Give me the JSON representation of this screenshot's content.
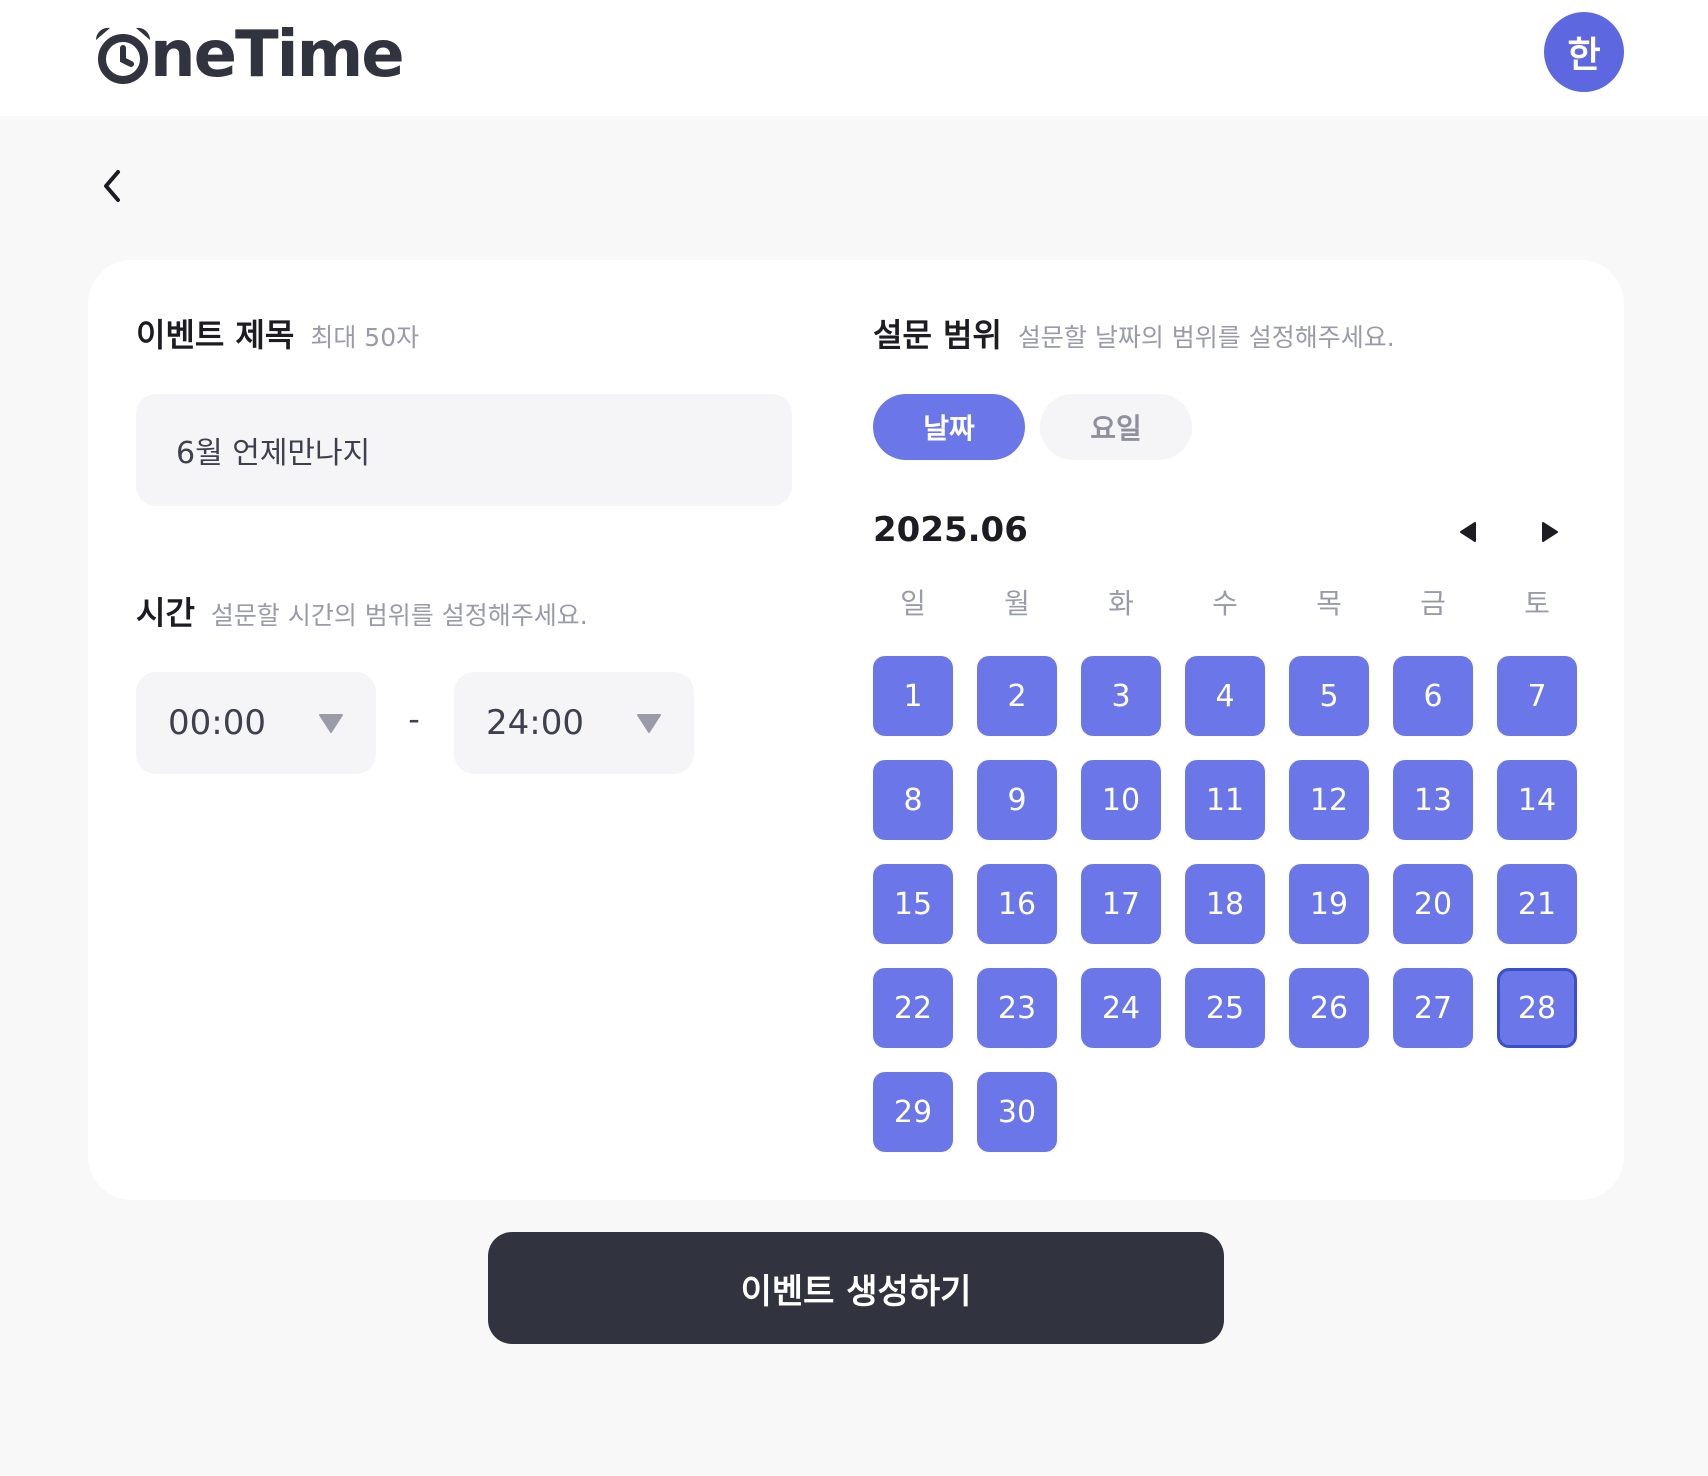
{
  "header": {
    "logo_text": "neTime",
    "avatar_initial": "한"
  },
  "title_section": {
    "label": "이벤트 제목",
    "hint": "최대 50자",
    "value": "6월 언제만나지"
  },
  "time_section": {
    "label": "시간",
    "hint": "설문할 시간의 범위를 설정해주세요.",
    "start": "00:00",
    "separator": "-",
    "end": "24:00"
  },
  "range_section": {
    "label": "설문 범위",
    "hint": "설문할 날짜의 범위를 설정해주세요.",
    "tabs": [
      {
        "label": "날짜",
        "active": true
      },
      {
        "label": "요일",
        "active": false
      }
    ]
  },
  "calendar": {
    "month_label": "2025.06",
    "weekdays": [
      "일",
      "월",
      "화",
      "수",
      "목",
      "금",
      "토"
    ],
    "days": [
      "1",
      "2",
      "3",
      "4",
      "5",
      "6",
      "7",
      "8",
      "9",
      "10",
      "11",
      "12",
      "13",
      "14",
      "15",
      "16",
      "17",
      "18",
      "19",
      "20",
      "21",
      "22",
      "23",
      "24",
      "25",
      "26",
      "27",
      "28",
      "29",
      "30"
    ],
    "first_weekday_index": 0,
    "highlighted_day": "28"
  },
  "submit_label": "이벤트 생성하기",
  "colors": {
    "accent": "#6b77e8",
    "avatar": "#5c67e0",
    "button_dark": "#31333f"
  }
}
